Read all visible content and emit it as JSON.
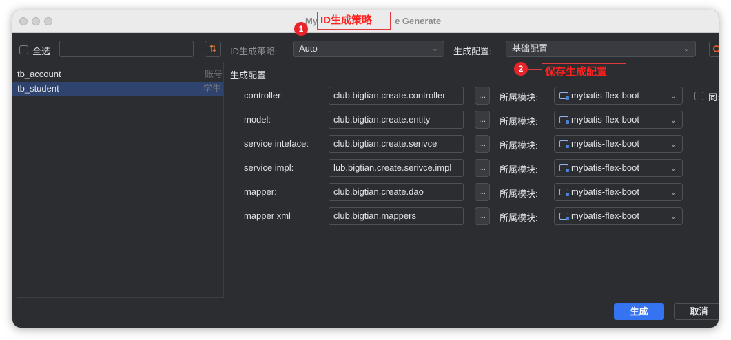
{
  "window": {
    "title_prefix": "My",
    "title_suffix": "e Generate"
  },
  "annotations": [
    {
      "number": "1",
      "label": "ID生成策略"
    },
    {
      "number": "2",
      "label": "保存生成配置"
    }
  ],
  "left_panel": {
    "select_all_label": "全选",
    "search_value": "",
    "sort_icon": "sort-icon",
    "tables": [
      {
        "name": "tb_account",
        "comment": "账号",
        "selected": false
      },
      {
        "name": "tb_student",
        "comment": "学生",
        "selected": true
      }
    ]
  },
  "top_bar": {
    "id_strategy_label": "ID生成策略:",
    "id_strategy_value": "Auto",
    "config_label": "生成配置:",
    "config_value": "基础配置"
  },
  "section_title": "生成配置",
  "rows": [
    {
      "label": "controller:",
      "package": "club.bigtian.create.controller",
      "browse": "...",
      "module_label": "所属模块:",
      "module": "mybatis-flex-boot"
    },
    {
      "label": "model:",
      "package": "club.bigtian.create.entity",
      "browse": "...",
      "module_label": "所属模块:",
      "module": "mybatis-flex-boot"
    },
    {
      "label": "service inteface:",
      "package": "club.bigtian.create.serivce",
      "browse": "...",
      "module_label": "所属模块:",
      "module": "mybatis-flex-boot"
    },
    {
      "label": "service impl:",
      "package": "lub.bigtian.create.serivce.impl",
      "browse": "...",
      "module_label": "所属模块:",
      "module": "mybatis-flex-boot"
    },
    {
      "label": "mapper:",
      "package": "club.bigtian.create.dao",
      "browse": "...",
      "module_label": "所属模块:",
      "module": "mybatis-flex-boot"
    },
    {
      "label": "mapper xml",
      "package": "club.bigtian.mappers",
      "browse": "...",
      "module_label": "所属模块:",
      "module": "mybatis-flex-boot"
    }
  ],
  "sync_label": "同:",
  "buttons": {
    "generate": "生成",
    "cancel": "取消"
  },
  "colors": {
    "window_bg": "#2b2d30",
    "primary_button": "#3574f0",
    "annotation_red": "#e5242b",
    "sort_icon": "#f0813c"
  }
}
